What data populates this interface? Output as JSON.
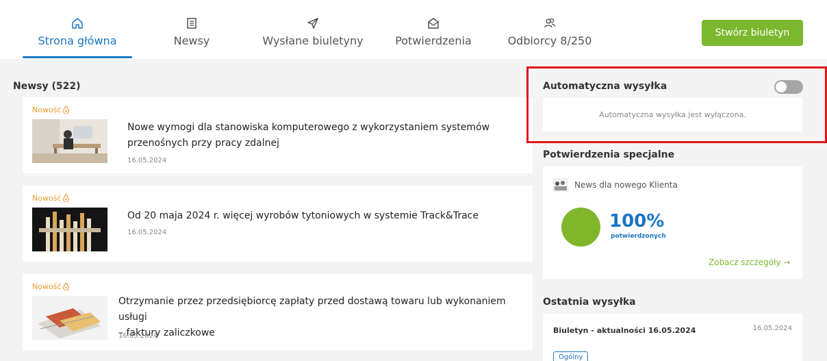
{
  "nav": {
    "tabs": [
      {
        "label": "Strona główna",
        "icon": "home-icon",
        "active": true
      },
      {
        "label": "Newsy",
        "icon": "newspaper-icon"
      },
      {
        "label": "Wysłane biuletyny",
        "icon": "paper-plane-icon"
      },
      {
        "label": "Potwierdzenia",
        "icon": "envelope-open-icon"
      },
      {
        "label": "Odbiorcy 8/250",
        "icon": "users-icon"
      }
    ],
    "create_label": "Stwórz biuletyn"
  },
  "news": {
    "title": "Newsy (522)",
    "items": [
      {
        "badge": "Nowość",
        "title_line1": "Nowe wymogi dla stanowiska komputerowego z wykorzystaniem systemów",
        "title_line2": "przenośnych przy pracy zdalnej",
        "date": "16.05.2024"
      },
      {
        "badge": "Nowość",
        "title_line1": "Od 20 maja 2024 r. więcej wyrobów tytoniowych w systemie Track&Trace",
        "title_line2": "",
        "date": "16.05.2024"
      },
      {
        "badge": "Nowość",
        "title_line1": "Otrzymanie przez przedsiębiorcę zapłaty przed dostawą towaru lub wykonaniem usługi",
        "title_line2": "– faktury zaliczkowe",
        "date": "16.05.2024"
      }
    ]
  },
  "auto": {
    "title": "Automatyczna wysyłka",
    "status": "Automatyczna wysyłka jest wyłączona.",
    "enabled": false
  },
  "special": {
    "title": "Potwierdzenia specjalne",
    "item_label": "News dla nowego Klienta",
    "percent": "100%",
    "percent_label": "potwierdzonych",
    "details_label": "Zobacz szczegóły →"
  },
  "last": {
    "title": "Ostatnia wysyłka",
    "item_title": "Biuletyn - aktualności 16.05.2024",
    "item_date": "16.05.2024",
    "tag": "Ogólny"
  },
  "colors": {
    "accent_blue": "#1976c5",
    "accent_green": "#7cb82f",
    "badge_orange": "#e89a2f",
    "highlight_red": "#e0161b"
  }
}
